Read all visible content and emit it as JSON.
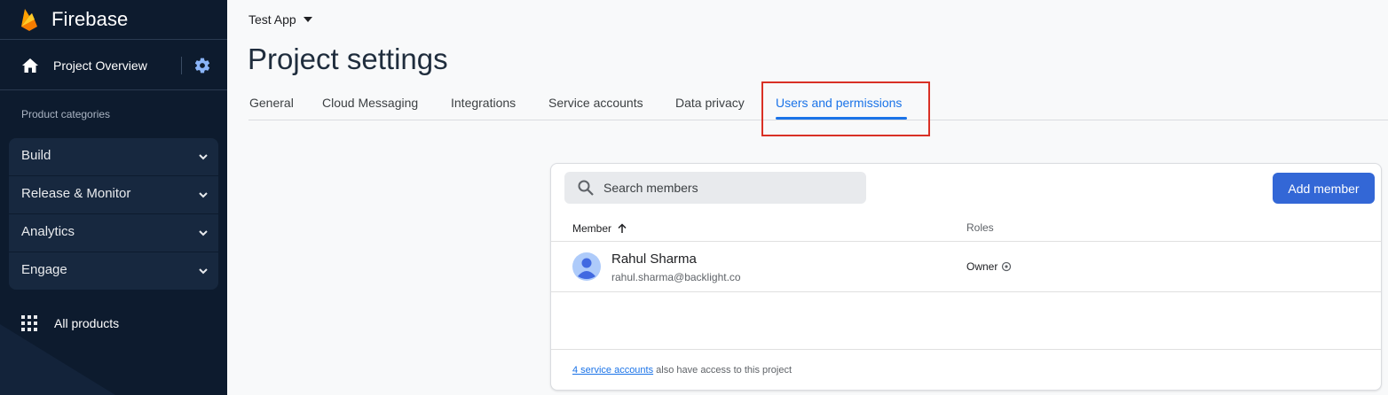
{
  "sidebar": {
    "brand": "Firebase",
    "project_overview": "Project Overview",
    "categories_label": "Product categories",
    "categories": [
      {
        "label": "Build"
      },
      {
        "label": "Release & Monitor"
      },
      {
        "label": "Analytics"
      },
      {
        "label": "Engage"
      }
    ],
    "all_products": "All products"
  },
  "header": {
    "project_name": "Test App",
    "title": "Project settings"
  },
  "tabs": [
    {
      "label": "General",
      "active": false
    },
    {
      "label": "Cloud Messaging",
      "active": false
    },
    {
      "label": "Integrations",
      "active": false
    },
    {
      "label": "Service accounts",
      "active": false
    },
    {
      "label": "Data privacy",
      "active": false
    },
    {
      "label": "Users and permissions",
      "active": true
    }
  ],
  "members": {
    "search_placeholder": "Search members",
    "add_button": "Add member",
    "col_member": "Member",
    "col_roles": "Roles",
    "rows": [
      {
        "name": "Rahul Sharma",
        "email": "rahul.sharma@backlight.co",
        "role": "Owner"
      }
    ],
    "footer_link": "4 service accounts",
    "footer_text": "also have access to this project"
  },
  "colors": {
    "sidebar_bg": "#0d1b2e",
    "accent": "#1a73e8",
    "button": "#3367d6",
    "highlight": "#d93025"
  }
}
